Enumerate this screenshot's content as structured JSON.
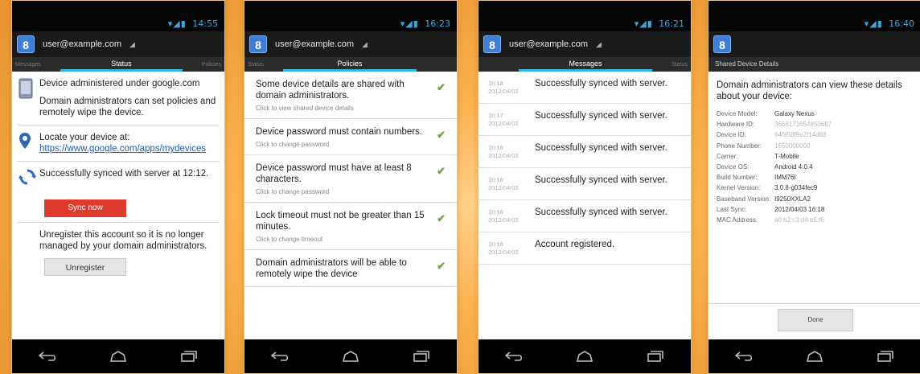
{
  "account": "user@example.com",
  "status_times": [
    "14:55",
    "16:23",
    "16:21",
    "16:40"
  ],
  "screen1": {
    "tab_left": "Messages",
    "tab_active": "Status",
    "tab_right": "Policies",
    "admin_text": "Device administered under google.com",
    "admin_desc": "Domain administrators can set policies and remotely wipe the device.",
    "locate_prefix": "Locate your device at: ",
    "locate_link": "https://www.google.com/apps/mydevices",
    "sync_text": "Successfully synced with server at 12:12.",
    "sync_button": "Sync now",
    "unregister_text": "Unregister this account so it is no longer managed by your domain administrators.",
    "unregister_button": "Unregister"
  },
  "screen2": {
    "tab_left": "Status",
    "tab_active": "Policies",
    "policies": [
      {
        "title": "Some device details are shared with domain administrators.",
        "sub": "Click to view shared device details"
      },
      {
        "title": "Device password must contain numbers.",
        "sub": "Click to change password"
      },
      {
        "title": "Device password must have at least 8 characters.",
        "sub": "Click to change password"
      },
      {
        "title": "Lock timeout must not be greater than 15 minutes.",
        "sub": "Click to change timeout"
      },
      {
        "title": "Domain administrators will be able to remotely wipe the device",
        "sub": ""
      }
    ]
  },
  "screen3": {
    "tab_active": "Messages",
    "tab_right": "Status",
    "messages": [
      {
        "time": "16:18",
        "date": "2012/04/03",
        "text": "Successfully synced with server."
      },
      {
        "time": "16:17",
        "date": "2012/04/03",
        "text": "Successfully synced with server."
      },
      {
        "time": "16:16",
        "date": "2012/04/03",
        "text": "Successfully synced with server."
      },
      {
        "time": "16:16",
        "date": "2012/04/03",
        "text": "Successfully synced with server."
      },
      {
        "time": "16:16",
        "date": "2012/04/03",
        "text": "Successfully synced with server."
      },
      {
        "time": "16:16",
        "date": "2012/04/03",
        "text": "Account registered."
      }
    ]
  },
  "screen4": {
    "title": "Shared Device Details",
    "heading": "Domain administrators can view these details about your device:",
    "details": [
      {
        "key": "Device Model:",
        "value": "Galaxy Nexus"
      },
      {
        "key": "Hardware ID:",
        "value": "3668171654850687"
      },
      {
        "key": "Device ID:",
        "value": "64f958f9e2f14d88"
      },
      {
        "key": "Phone Number:",
        "value": "1650000000"
      },
      {
        "key": "Carrier:",
        "value": "T-Mobile"
      },
      {
        "key": "Device OS:",
        "value": "Android 4.0.4"
      },
      {
        "key": "Build Number:",
        "value": "IMM76I"
      },
      {
        "key": "Kernel Version:",
        "value": "3.0.8-g034fec9"
      },
      {
        "key": "Baseband Version:",
        "value": "I9250XXLA2"
      },
      {
        "key": "Last Sync:",
        "value": "2012/04/03 16:18"
      },
      {
        "key": "MAC Address:",
        "value": "a0:b2:c3:d4:e5:f6"
      }
    ],
    "done_button": "Done"
  }
}
